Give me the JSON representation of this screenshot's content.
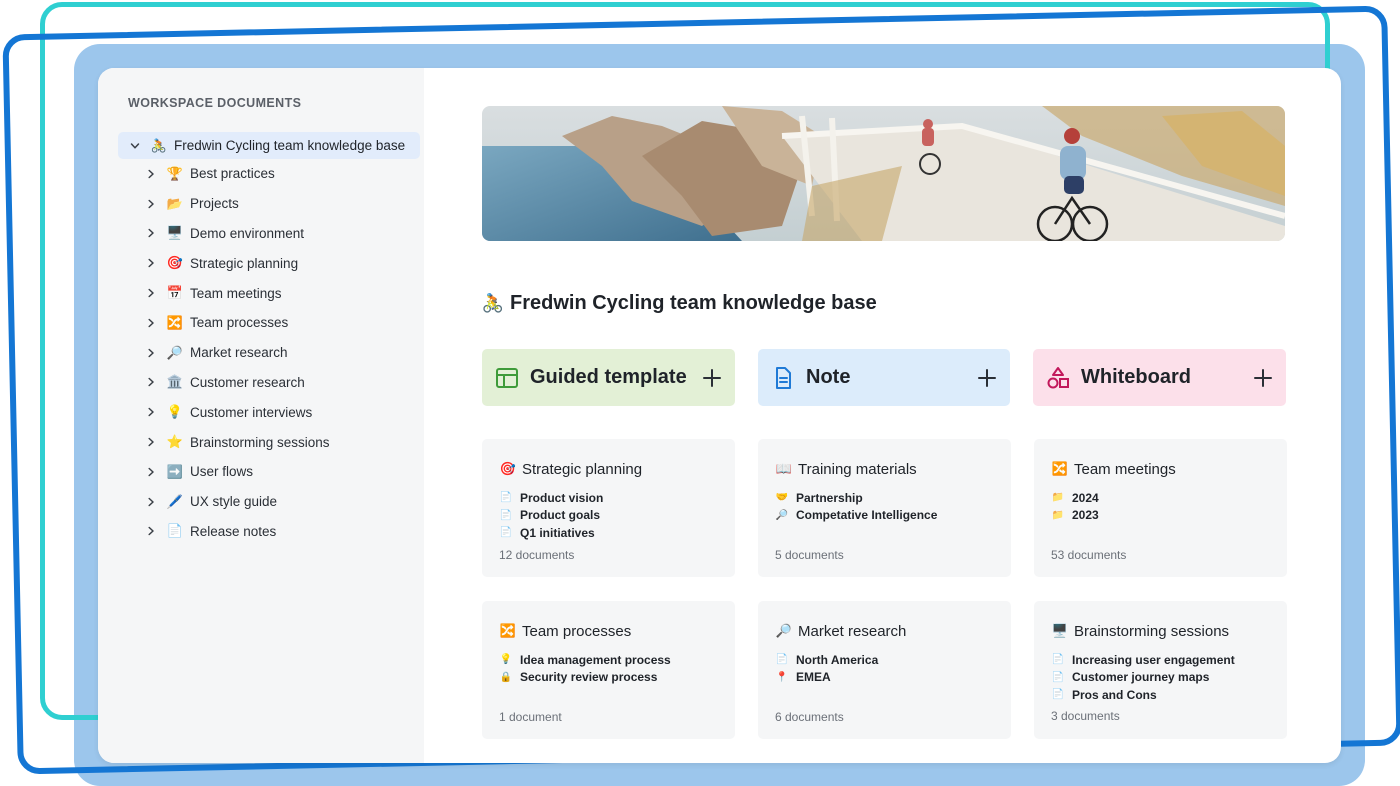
{
  "sidebar": {
    "title": "WORKSPACE DOCUMENTS",
    "root": {
      "emoji": "🚴",
      "label": "Fredwin Cycling team knowledge base"
    },
    "items": [
      {
        "emoji": "🏆",
        "label": "Best practices"
      },
      {
        "emoji": "📂",
        "label": "Projects"
      },
      {
        "emoji": "🖥️",
        "label": "Demo environment"
      },
      {
        "emoji": "🎯",
        "label": "Strategic planning"
      },
      {
        "emoji": "📅",
        "label": "Team meetings"
      },
      {
        "emoji": "🔀",
        "label": "Team processes"
      },
      {
        "emoji": "🔎",
        "label": "Market research"
      },
      {
        "emoji": "🏛️",
        "label": "Customer research"
      },
      {
        "emoji": "💡",
        "label": "Customer interviews"
      },
      {
        "emoji": "⭐",
        "label": "Brainstorming sessions"
      },
      {
        "emoji": "➡️",
        "label": "User flows"
      },
      {
        "emoji": "🖊️",
        "label": "UX style guide"
      },
      {
        "emoji": "📄",
        "label": "Release notes"
      }
    ]
  },
  "main": {
    "title_emoji": "🚴",
    "title": "Fredwin Cycling team knowledge base",
    "create_buttons": [
      {
        "label": "Guided template",
        "icon": "layout-template-icon",
        "color": "#e3f0d6"
      },
      {
        "label": "Note",
        "icon": "document-icon",
        "color": "#dcecfb"
      },
      {
        "label": "Whiteboard",
        "icon": "shapes-icon",
        "color": "#fce0ea"
      }
    ],
    "cards": [
      {
        "emoji": "🎯",
        "title": "Strategic planning",
        "docs": [
          {
            "emoji": "📄",
            "label": "Product vision"
          },
          {
            "emoji": "📄",
            "label": "Product goals"
          },
          {
            "emoji": "📄",
            "label": "Q1 initiatives"
          }
        ],
        "count": "12 documents"
      },
      {
        "emoji": "📖",
        "title": "Training materials",
        "docs": [
          {
            "emoji": "🤝",
            "label": "Partnership"
          },
          {
            "emoji": "🔎",
            "label": "Competative Intelligence"
          }
        ],
        "count": "5 documents"
      },
      {
        "emoji": "🔀",
        "title": "Team meetings",
        "docs": [
          {
            "emoji": "📁",
            "label": "2024"
          },
          {
            "emoji": "📁",
            "label": "2023"
          }
        ],
        "count": "53 documents"
      },
      {
        "emoji": "🔀",
        "title": "Team processes",
        "docs": [
          {
            "emoji": "💡",
            "label": "Idea management process"
          },
          {
            "emoji": "🔒",
            "label": "Security review process"
          }
        ],
        "count": "1 document"
      },
      {
        "emoji": "🔎",
        "title": "Market research",
        "docs": [
          {
            "emoji": "📄",
            "label": "North America"
          },
          {
            "emoji": "📍",
            "label": "EMEA"
          }
        ],
        "count": "6 documents"
      },
      {
        "emoji": "🖥️",
        "title": "Brainstorming sessions",
        "docs": [
          {
            "emoji": "📄",
            "label": "Increasing user engagement"
          },
          {
            "emoji": "📄",
            "label": "Customer journey maps"
          },
          {
            "emoji": "📄",
            "label": "Pros and Cons"
          }
        ],
        "count": "3 documents"
      }
    ]
  }
}
